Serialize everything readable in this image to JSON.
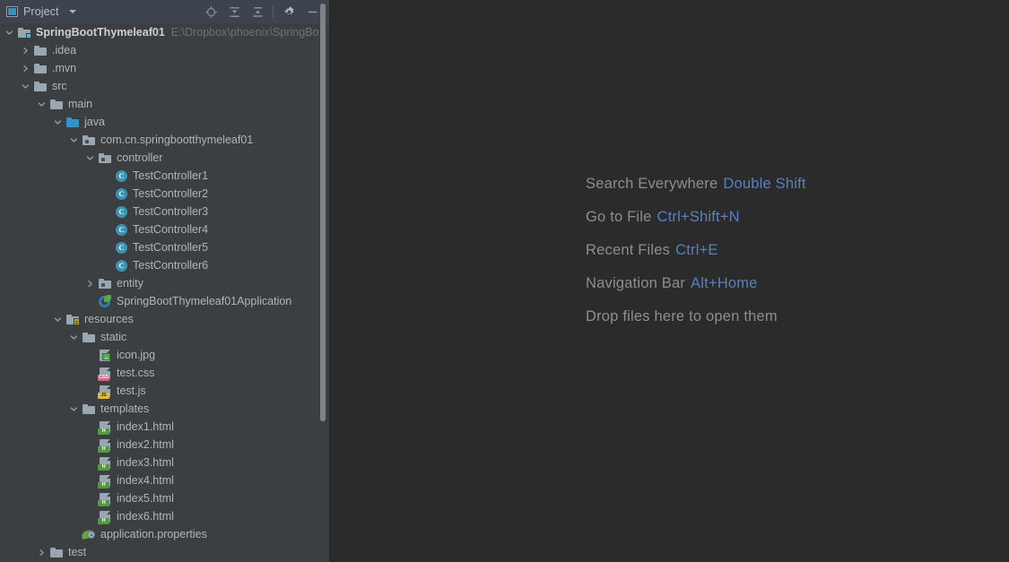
{
  "window": {
    "tool_window_title": "Project",
    "toolbar_icons": [
      "locate-target-icon",
      "expand-all-icon",
      "collapse-all-icon",
      "settings-gear-icon",
      "minimize-icon"
    ]
  },
  "project_tree": {
    "rows": [
      {
        "label": "SpringBootThymeleaf01",
        "path": "E:\\Dropbox\\phoenix\\SpringBo",
        "indent": 0,
        "arrow": "down",
        "icon": "module-folder-icon",
        "kind": "root"
      },
      {
        "label": ".idea",
        "indent": 1,
        "arrow": "right",
        "icon": "folder-icon",
        "kind": "folder"
      },
      {
        "label": ".mvn",
        "indent": 1,
        "arrow": "right",
        "icon": "folder-icon",
        "kind": "folder"
      },
      {
        "label": "src",
        "indent": 1,
        "arrow": "down",
        "icon": "folder-icon",
        "kind": "folder"
      },
      {
        "label": "main",
        "indent": 2,
        "arrow": "down",
        "icon": "folder-icon",
        "kind": "folder"
      },
      {
        "label": "java",
        "indent": 3,
        "arrow": "down",
        "icon": "source-root-folder-icon",
        "kind": "source-root"
      },
      {
        "label": "com.cn.springbootthymeleaf01",
        "indent": 4,
        "arrow": "down",
        "icon": "package-icon",
        "kind": "package"
      },
      {
        "label": "controller",
        "indent": 5,
        "arrow": "down",
        "icon": "package-icon",
        "kind": "package"
      },
      {
        "label": "TestController1",
        "indent": 6,
        "arrow": "none",
        "icon": "java-class-icon",
        "kind": "class"
      },
      {
        "label": "TestController2",
        "indent": 6,
        "arrow": "none",
        "icon": "java-class-icon",
        "kind": "class"
      },
      {
        "label": "TestController3",
        "indent": 6,
        "arrow": "none",
        "icon": "java-class-icon",
        "kind": "class"
      },
      {
        "label": "TestController4",
        "indent": 6,
        "arrow": "none",
        "icon": "java-class-icon",
        "kind": "class"
      },
      {
        "label": "TestController5",
        "indent": 6,
        "arrow": "none",
        "icon": "java-class-icon",
        "kind": "class"
      },
      {
        "label": "TestController6",
        "indent": 6,
        "arrow": "none",
        "icon": "java-class-icon",
        "kind": "class"
      },
      {
        "label": "entity",
        "indent": 5,
        "arrow": "right",
        "icon": "package-icon",
        "kind": "package"
      },
      {
        "label": "SpringBootThymeleaf01Application",
        "indent": 5,
        "arrow": "none",
        "icon": "spring-boot-app-icon",
        "kind": "spring-app"
      },
      {
        "label": "resources",
        "indent": 3,
        "arrow": "down",
        "icon": "resources-folder-icon",
        "kind": "resources"
      },
      {
        "label": "static",
        "indent": 4,
        "arrow": "down",
        "icon": "folder-icon",
        "kind": "folder"
      },
      {
        "label": "icon.jpg",
        "indent": 5,
        "arrow": "none",
        "icon": "image-file-icon",
        "kind": "image"
      },
      {
        "label": "test.css",
        "indent": 5,
        "arrow": "none",
        "icon": "css-file-icon",
        "kind": "css"
      },
      {
        "label": "test.js",
        "indent": 5,
        "arrow": "none",
        "icon": "js-file-icon",
        "kind": "js"
      },
      {
        "label": "templates",
        "indent": 4,
        "arrow": "down",
        "icon": "folder-icon",
        "kind": "folder"
      },
      {
        "label": "index1.html",
        "indent": 5,
        "arrow": "none",
        "icon": "html-file-icon",
        "kind": "html"
      },
      {
        "label": "index2.html",
        "indent": 5,
        "arrow": "none",
        "icon": "html-file-icon",
        "kind": "html"
      },
      {
        "label": "index3.html",
        "indent": 5,
        "arrow": "none",
        "icon": "html-file-icon",
        "kind": "html"
      },
      {
        "label": "index4.html",
        "indent": 5,
        "arrow": "none",
        "icon": "html-file-icon",
        "kind": "html"
      },
      {
        "label": "index5.html",
        "indent": 5,
        "arrow": "none",
        "icon": "html-file-icon",
        "kind": "html"
      },
      {
        "label": "index6.html",
        "indent": 5,
        "arrow": "none",
        "icon": "html-file-icon",
        "kind": "html"
      },
      {
        "label": "application.properties",
        "indent": 4,
        "arrow": "none",
        "icon": "spring-properties-icon",
        "kind": "properties"
      },
      {
        "label": "test",
        "indent": 2,
        "arrow": "right",
        "icon": "folder-icon",
        "kind": "folder"
      }
    ]
  },
  "editor_empty_state": {
    "hints": [
      {
        "action": "Search Everywhere",
        "shortcut": "Double Shift"
      },
      {
        "action": "Go to File",
        "shortcut": "Ctrl+Shift+N"
      },
      {
        "action": "Recent Files",
        "shortcut": "Ctrl+E"
      },
      {
        "action": "Navigation Bar",
        "shortcut": "Alt+Home"
      },
      {
        "action": "Drop files here to open them",
        "shortcut": ""
      }
    ]
  },
  "colors": {
    "panel_bg": "#3c3f41",
    "header_bg": "#3d4450",
    "editor_bg": "#2b2b2b",
    "tree_text": "#b4b4b4",
    "path_text": "#6e7277",
    "shortcut_blue": "#5880c0",
    "hint_text": "#8a8f94",
    "source_root_blue": "#3592c4"
  }
}
